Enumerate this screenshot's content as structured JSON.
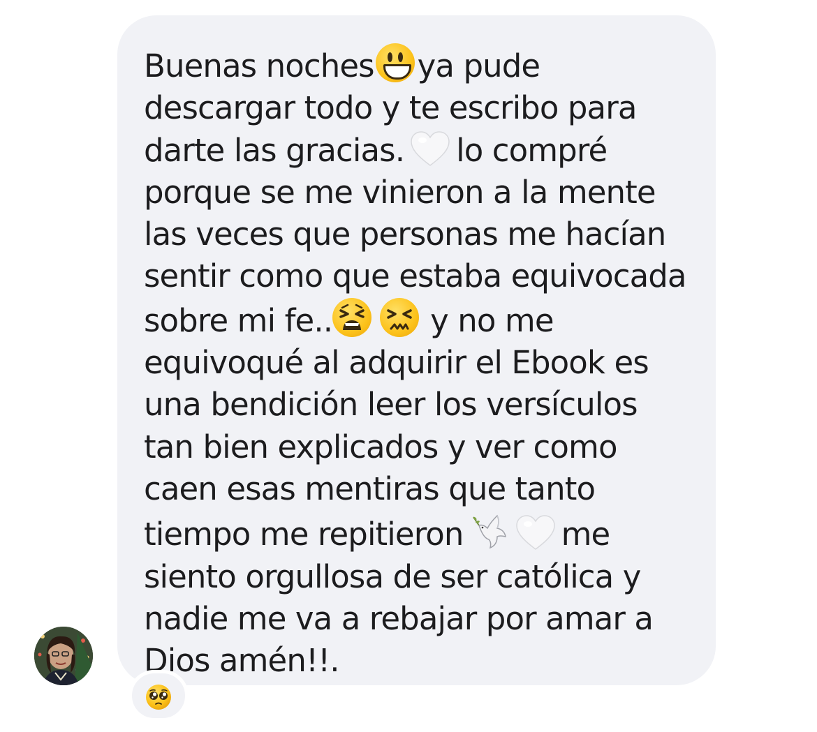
{
  "message": {
    "lines": [
      "Buenas noches",
      "ya pude",
      "descargar todo y te escribo para",
      "darte las gracias.",
      "lo compré",
      "porque se me vinieron a la mente",
      "las veces que personas me hacían",
      "sentir como que estaba equivocada",
      "sobre mi fe..",
      "y no me",
      "equivoqué al adquirir el Ebook es",
      "una bendición leer los versículos",
      "tan bien explicados y ver como",
      "caen esas mentiras que tanto",
      "tiempo me repitieron",
      "me",
      "siento orgullosa de ser católica y",
      "nadie me va a rebajar por amar a",
      "Dios amén!!."
    ],
    "emojis": [
      "grinning-face",
      "white-heart",
      "tired-face",
      "confounded-face",
      "dove",
      "white-heart"
    ]
  },
  "reaction": {
    "emoji": "pleading-face"
  },
  "colors": {
    "bubble_bg": "#f1f2f6",
    "text": "#1c1c1e",
    "page_bg": "#ffffff"
  }
}
